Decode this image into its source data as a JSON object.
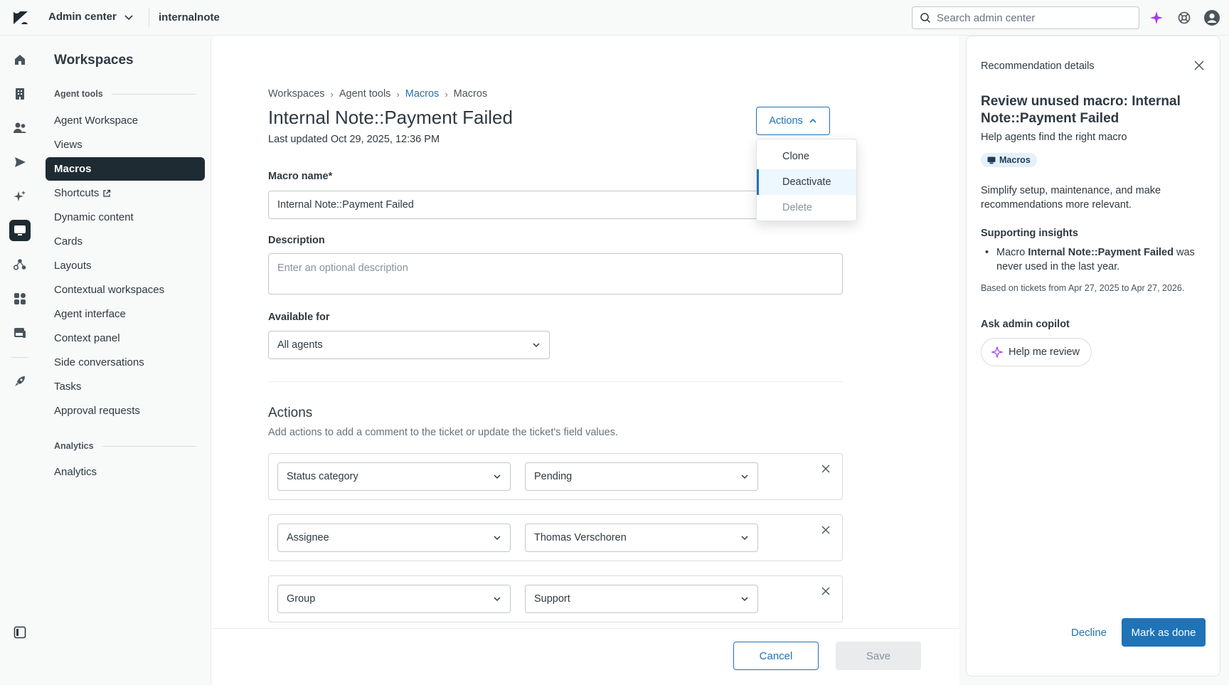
{
  "topbar": {
    "product": "Admin center",
    "account": "internalnote",
    "search_placeholder": "Search admin center"
  },
  "subnav": {
    "title": "Workspaces",
    "section_agent_tools": "Agent tools",
    "items": [
      {
        "label": "Agent Workspace"
      },
      {
        "label": "Views"
      },
      {
        "label": "Macros"
      },
      {
        "label": "Shortcuts"
      },
      {
        "label": "Dynamic content"
      },
      {
        "label": "Cards"
      },
      {
        "label": "Layouts"
      },
      {
        "label": "Contextual workspaces"
      },
      {
        "label": "Agent interface"
      },
      {
        "label": "Context panel"
      },
      {
        "label": "Side conversations"
      },
      {
        "label": "Tasks"
      },
      {
        "label": "Approval requests"
      }
    ],
    "section_analytics": "Analytics",
    "analytics_item": "Analytics"
  },
  "main": {
    "breadcrumb": [
      "Workspaces",
      "Agent tools",
      "Macros",
      "Macros"
    ],
    "title": "Internal Note::Payment Failed",
    "last_updated": "Last updated Oct 29, 2025, 12:36 PM",
    "actions_button": "Actions",
    "actions_menu": [
      "Clone",
      "Deactivate",
      "Delete"
    ],
    "macro_name_label": "Macro name*",
    "macro_name_value": "Internal Note::Payment Failed",
    "description_label": "Description",
    "description_placeholder": "Enter an optional description",
    "available_for_label": "Available for",
    "available_for_value": "All agents",
    "actions_title": "Actions",
    "actions_desc": "Add actions to add a comment to the ticket or update the ticket's field values.",
    "action_rows": [
      {
        "field": "Status category",
        "value": "Pending"
      },
      {
        "field": "Assignee",
        "value": "Thomas Verschoren"
      },
      {
        "field": "Group",
        "value": "Support"
      }
    ],
    "cancel": "Cancel",
    "save": "Save"
  },
  "panel": {
    "header": "Recommendation details",
    "title": "Review unused macro: Internal Note::Payment Failed",
    "subtitle": "Help agents find the right macro",
    "tag": "Macros",
    "paragraph": "Simplify setup, maintenance, and make recommendations more relevant.",
    "insights_heading": "Supporting insights",
    "insight_prefix": "Macro ",
    "insight_bold": "Internal Note::Payment Failed",
    "insight_suffix": " was never used in the last year.",
    "based_on": "Based on tickets from Apr 27, 2025 to Apr 27, 2026.",
    "copilot_heading": "Ask admin copilot",
    "copilot_button": "Help me review",
    "decline": "Decline",
    "mark_done": "Mark as done"
  },
  "colors": {
    "accent": "#1f73b7",
    "nav_active": "#1f2b33",
    "copilot": "#a13ef0"
  },
  "icons": [
    "zendesk-logo",
    "chevron-down-icon",
    "search-icon",
    "sparkle-icon",
    "help-icon",
    "avatar-icon",
    "home-icon",
    "building-icon",
    "people-icon",
    "send-icon",
    "ai-icon",
    "workspace-icon",
    "objects-icon",
    "apps-icon",
    "channels-icon",
    "rocket-icon",
    "panel-toggle-icon",
    "external-link-icon",
    "close-icon",
    "chevron-up-icon",
    "chat-icon"
  ]
}
